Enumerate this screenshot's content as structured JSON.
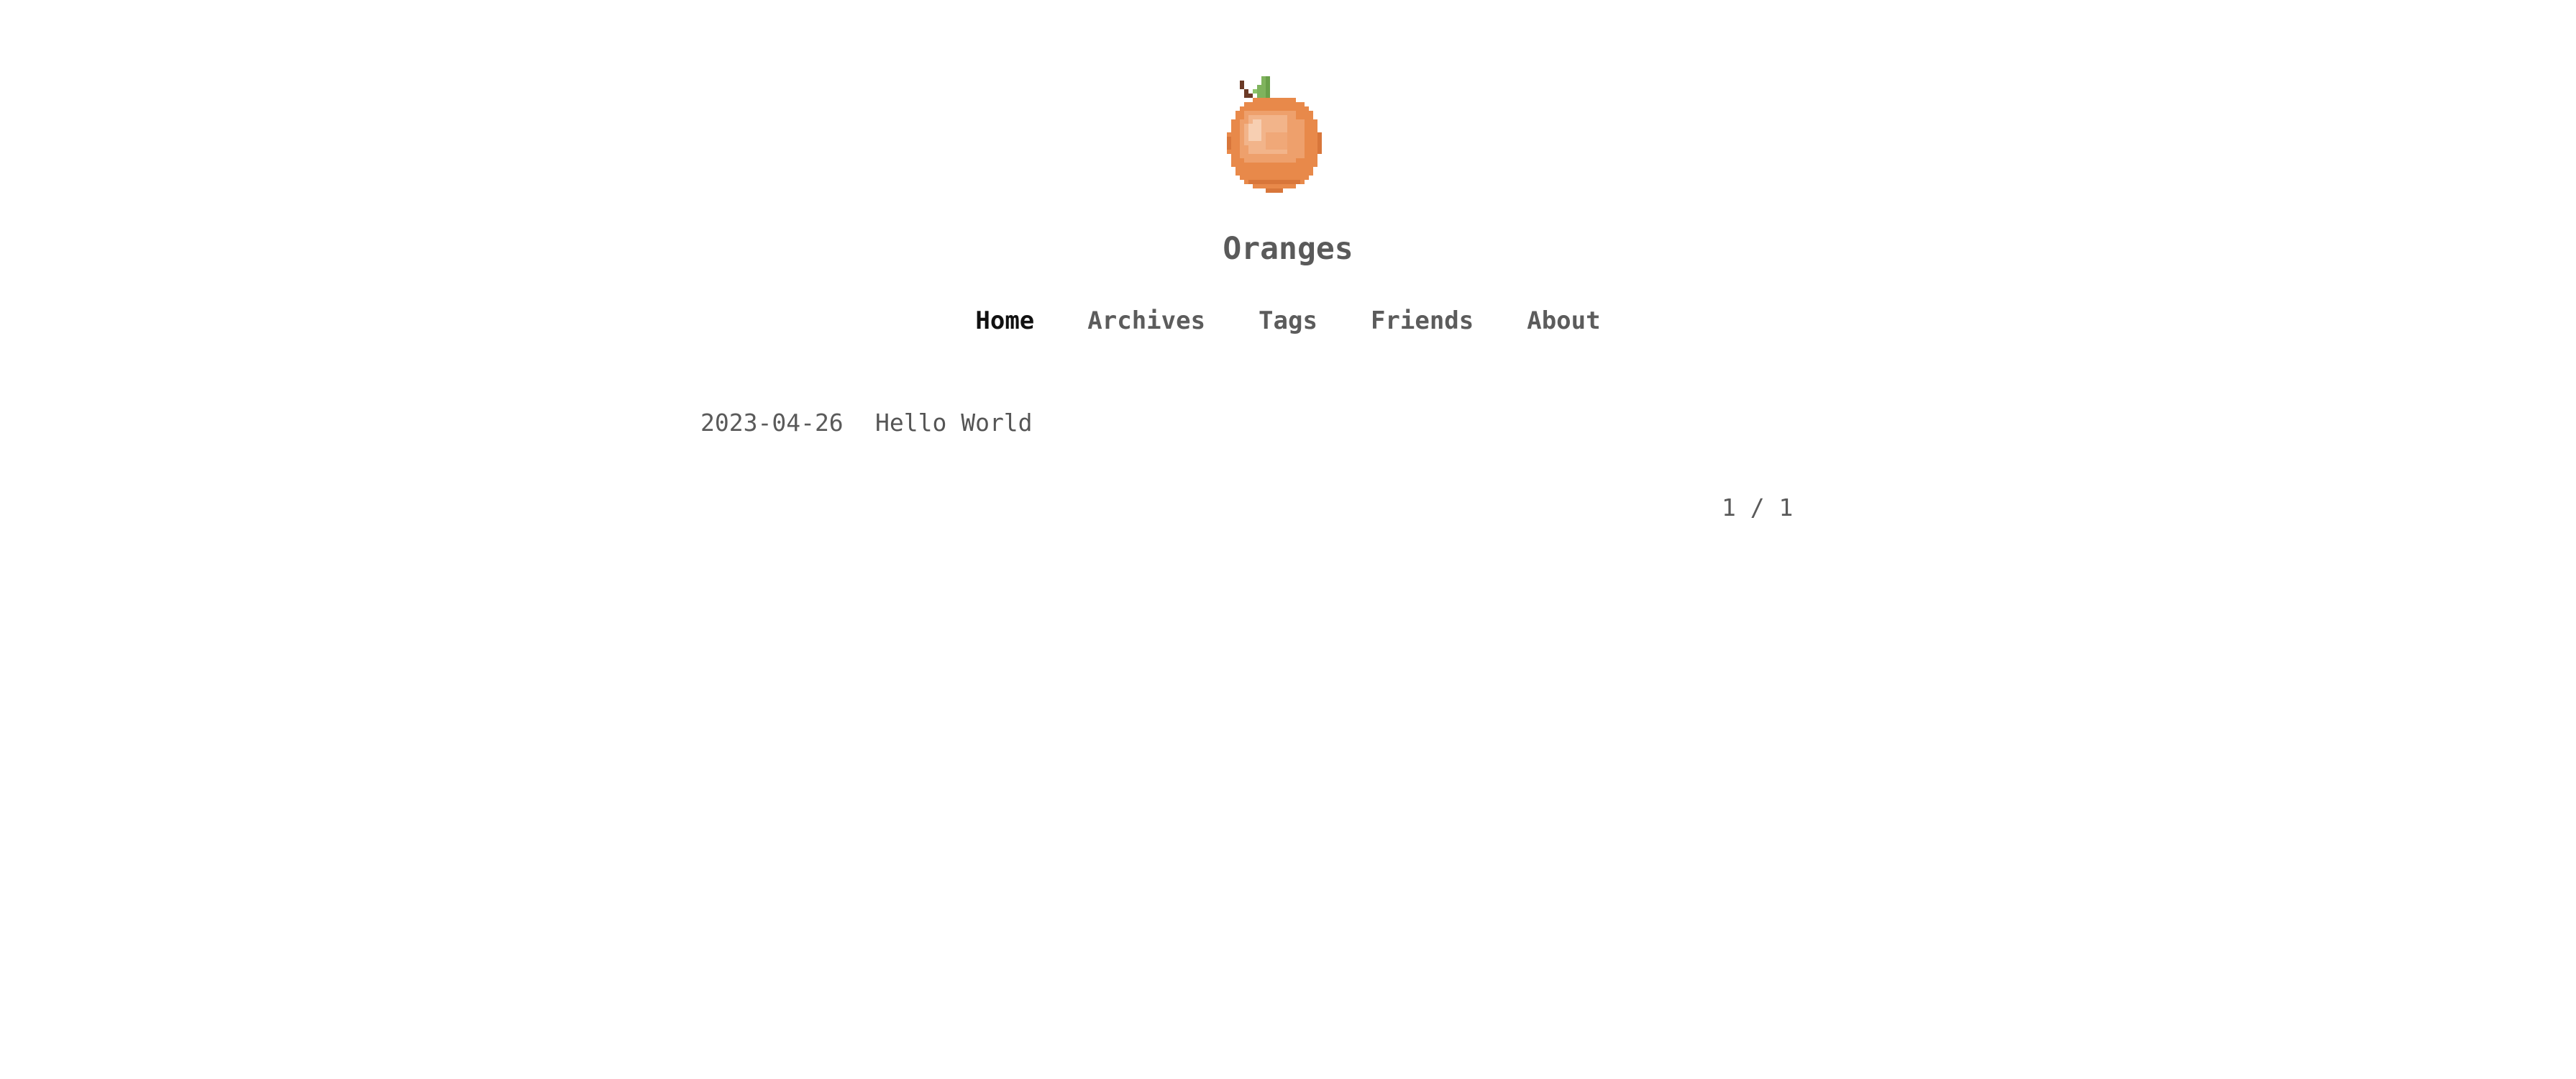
{
  "site": {
    "title": "Oranges",
    "logo_icon": "orange-fruit-icon"
  },
  "nav": {
    "items": [
      {
        "label": "Home",
        "active": true
      },
      {
        "label": "Archives",
        "active": false
      },
      {
        "label": "Tags",
        "active": false
      },
      {
        "label": "Friends",
        "active": false
      },
      {
        "label": "About",
        "active": false
      }
    ]
  },
  "posts": [
    {
      "date": "2023-04-26",
      "title": "Hello World"
    }
  ],
  "pagination": {
    "text": "1 / 1"
  },
  "colors": {
    "orange": "#e8894a",
    "orange_light": "#f2b48a",
    "leaf": "#7fb35d",
    "stem": "#6b3a26",
    "text": "#555555",
    "active_underline": "#a9a9a9"
  }
}
